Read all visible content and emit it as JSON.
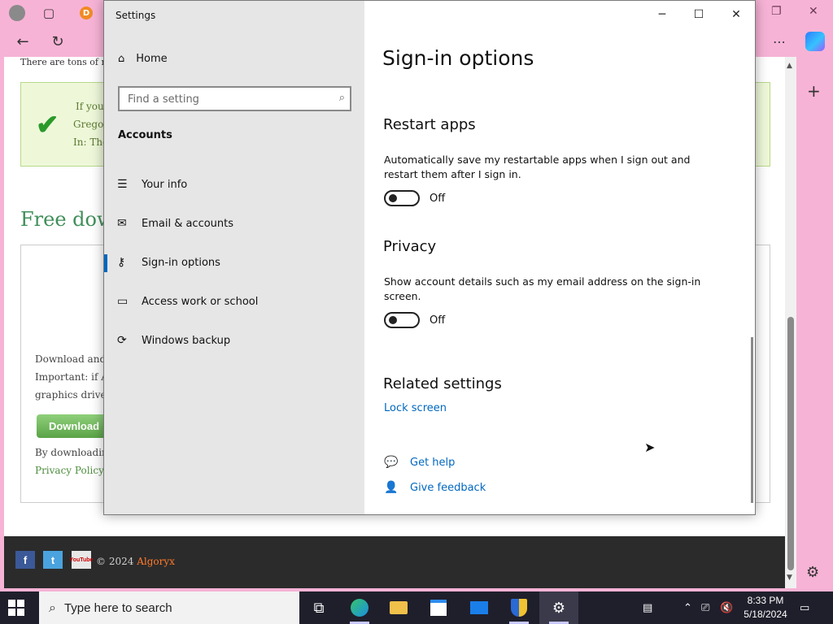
{
  "browser": {
    "tab_icon_letter": "D",
    "web": {
      "intro": "There are tons of re",
      "note_lines": [
        "If you",
        "Gregor",
        "In: The"
      ],
      "heading": "Free dow",
      "para_lines": [
        "Download and d",
        "Important: if Alg",
        "graphics drivers"
      ],
      "download_label": "Download",
      "by_line": "By downloading",
      "privacy_link": "Privacy Policy.",
      "copyright_prefix": "© 2024",
      "copyright_brand": "Algoryx",
      "youtube_label": "YouTube"
    }
  },
  "settings": {
    "window_title": "Settings",
    "home_label": "Home",
    "search_placeholder": "Find a setting",
    "section_title": "Accounts",
    "nav": [
      {
        "label": "Your info",
        "icon": "person-list-icon"
      },
      {
        "label": "Email & accounts",
        "icon": "mail-icon"
      },
      {
        "label": "Sign-in options",
        "icon": "key-icon"
      },
      {
        "label": "Access work or school",
        "icon": "briefcase-icon"
      },
      {
        "label": "Windows backup",
        "icon": "sync-icon"
      }
    ],
    "active_nav": "Sign-in options",
    "page_title": "Sign-in options",
    "restart": {
      "heading": "Restart apps",
      "desc": "Automatically save my restartable apps when I sign out and restart them after I sign in.",
      "state": "Off"
    },
    "privacy": {
      "heading": "Privacy",
      "desc": "Show account details such as my email address on the sign-in screen.",
      "state": "Off"
    },
    "related": {
      "heading": "Related settings",
      "link": "Lock screen"
    },
    "help": {
      "get_help": "Get help",
      "feedback": "Give feedback"
    },
    "accent": "#0067c0"
  },
  "taskbar": {
    "search_placeholder": "Type here to search",
    "time": "8:33 PM",
    "date": "5/18/2024"
  }
}
